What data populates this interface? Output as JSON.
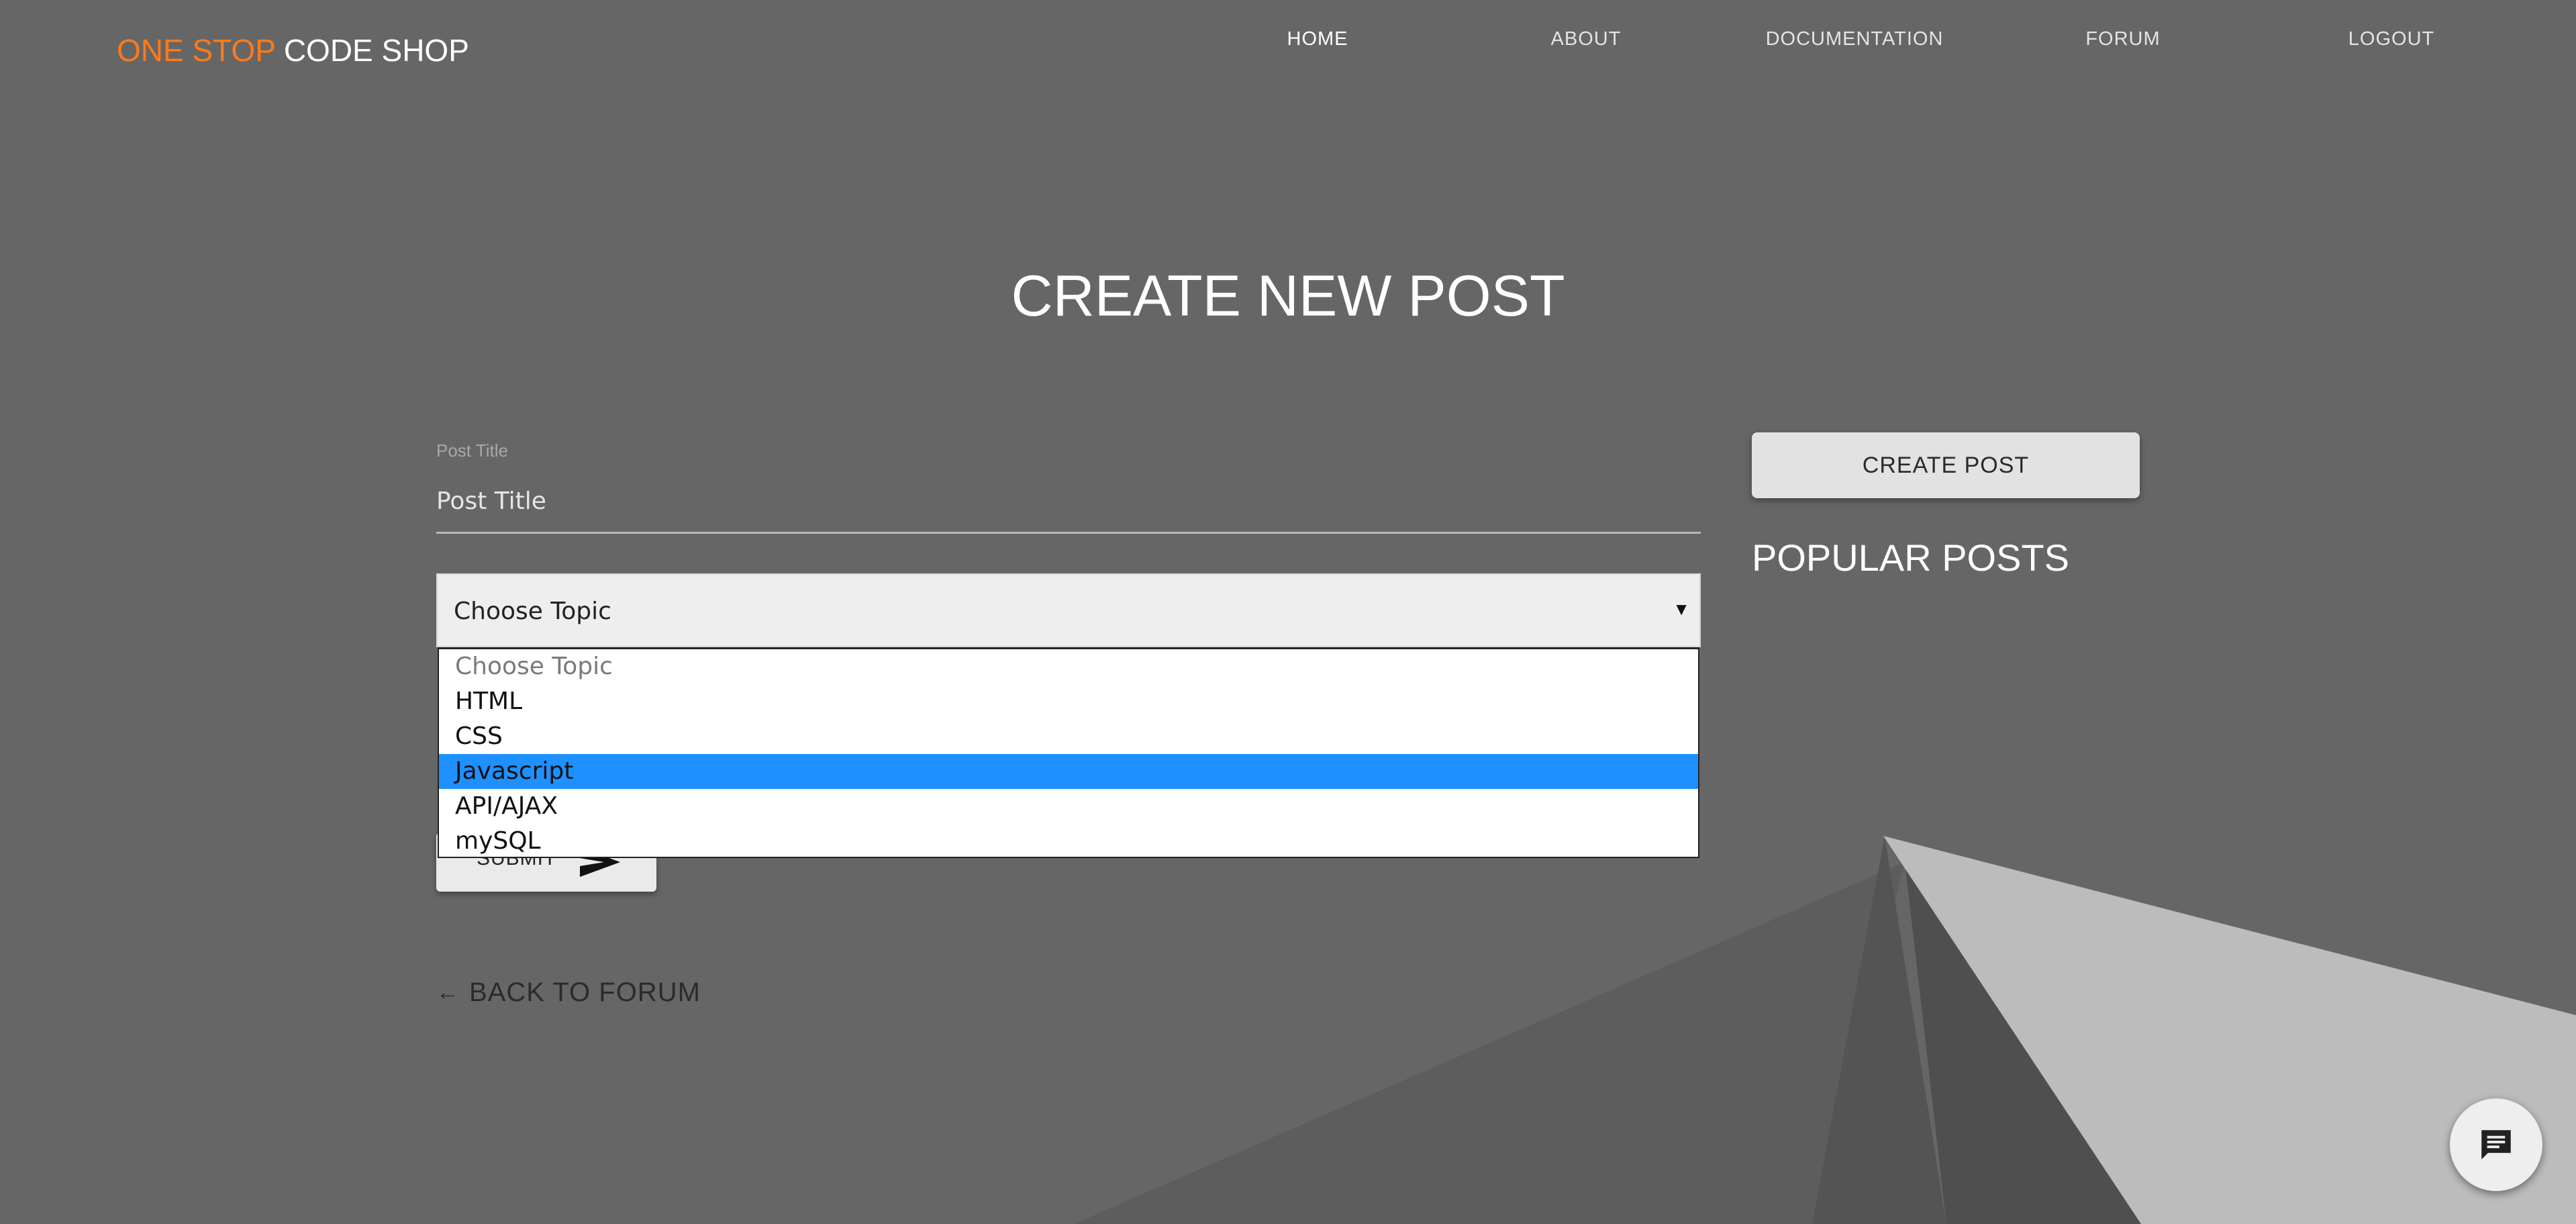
{
  "brand": {
    "accent": "ONE STOP",
    "rest": "CODE SHOP"
  },
  "nav": [
    {
      "label": "HOME",
      "active": true
    },
    {
      "label": "ABOUT",
      "active": false
    },
    {
      "label": "DOCUMENTATION",
      "active": false
    },
    {
      "label": "FORUM",
      "active": false
    },
    {
      "label": "LOGOUT",
      "active": false
    }
  ],
  "page": {
    "title": "CREATE NEW POST"
  },
  "form": {
    "title_label": "Post Title",
    "title_placeholder": "Post Title",
    "title_value": "",
    "topic_select": {
      "selected": "Choose Topic",
      "options": [
        "Choose Topic",
        "HTML",
        "CSS",
        "Javascript",
        "API/AJAX",
        "mySQL"
      ],
      "highlighted": "Javascript"
    },
    "submit_label": "SUBMIT"
  },
  "back_link": {
    "label": "BACK TO FORUM",
    "icon": "arrow-left-icon"
  },
  "sidebar": {
    "create_post_label": "CREATE POST",
    "popular_heading": "POPULAR POSTS"
  },
  "chat": {
    "icon": "chat-icon"
  },
  "colors": {
    "background": "#666666",
    "brand_accent": "#ff7a1a",
    "dropdown_highlight": "#1e90ff"
  }
}
